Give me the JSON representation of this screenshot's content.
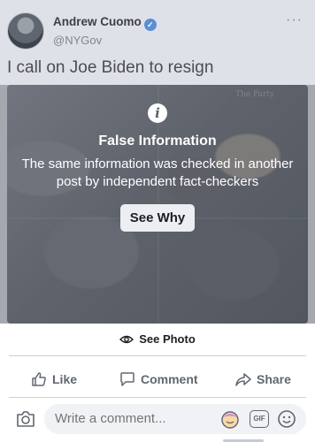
{
  "post": {
    "author": "Andrew Cuomo",
    "handle": "@NYGov",
    "text": "I call on Joe Biden to resign",
    "photo_sign_text": "The Party"
  },
  "warning": {
    "title": "False Information",
    "description": "The same information was checked in another post by independent fact-checkers",
    "button_label": "See Why"
  },
  "see_photo_label": "See Photo",
  "actions": {
    "like": "Like",
    "comment": "Comment",
    "share": "Share"
  },
  "comment_bar": {
    "placeholder": "Write a comment...",
    "gif_label": "GIF"
  },
  "colors": {
    "verified": "#5a8fd6",
    "action_text": "#606770",
    "overlay": "#3c4048"
  }
}
